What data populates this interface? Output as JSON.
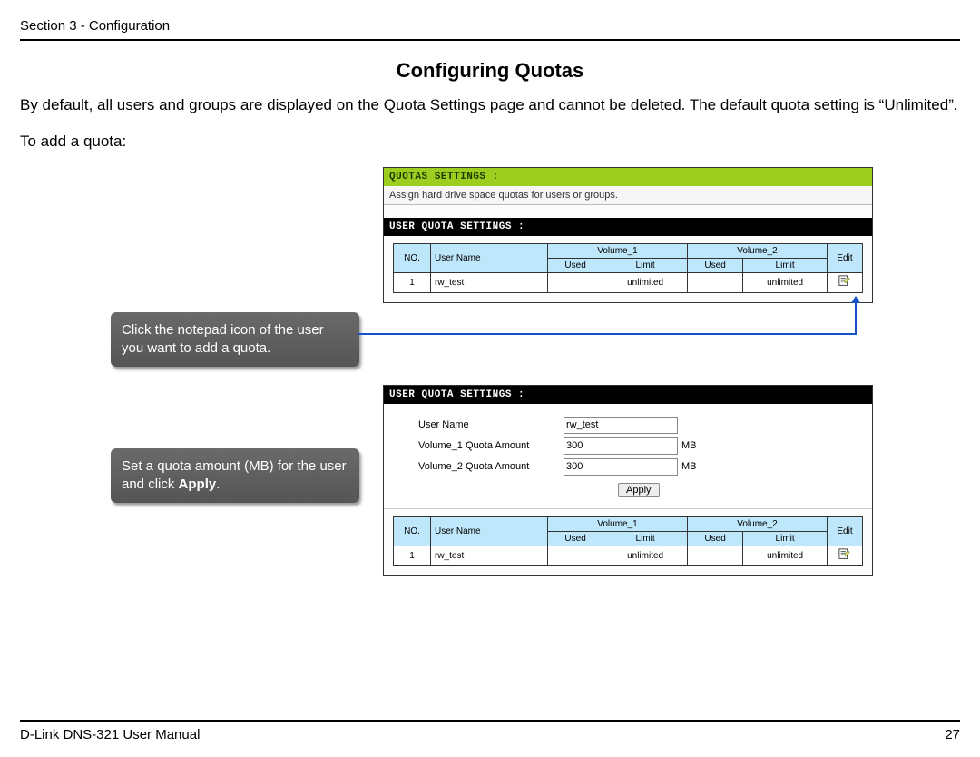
{
  "header": {
    "section": "Section 3 - Configuration"
  },
  "title": "Configuring Quotas",
  "para1": "By default, all users and groups are displayed on the Quota Settings page and cannot be deleted.  The default quota setting is “Unlimited”.",
  "para2": "To add a quota:",
  "callout1_a": "Click the notepad icon of the user you want to add a quota.",
  "callout2_a": "Set a quota amount (MB) for the user and click ",
  "callout2_b": "Apply",
  "callout2_c": ".",
  "panel1": {
    "title": "QUOTAS SETTINGS :",
    "sub": "Assign hard drive space quotas for users or groups.",
    "black": "USER QUOTA SETTINGS :",
    "cols": {
      "no": "NO.",
      "user": "User Name",
      "v1": "Volume_1",
      "v2": "Volume_2",
      "used": "Used",
      "limit": "Limit",
      "edit": "Edit"
    },
    "row": {
      "no": "1",
      "user": "rw_test",
      "v1_used": "",
      "v1_limit": "unlimited",
      "v2_used": "",
      "v2_limit": "unlimited"
    }
  },
  "panel2": {
    "black": "USER QUOTA SETTINGS :",
    "labels": {
      "user": "User Name",
      "v1q": "Volume_1 Quota Amount",
      "v2q": "Volume_2 Quota Amount",
      "mb": "MB",
      "apply": "Apply"
    },
    "values": {
      "user": "rw_test",
      "v1q": "300",
      "v2q": "300"
    },
    "cols": {
      "no": "NO.",
      "user": "User Name",
      "v1": "Volume_1",
      "v2": "Volume_2",
      "used": "Used",
      "limit": "Limit",
      "edit": "Edit"
    },
    "row": {
      "no": "1",
      "user": "rw_test",
      "v1_used": "",
      "v1_limit": "unlimited",
      "v2_used": "",
      "v2_limit": "unlimited"
    }
  },
  "footer": {
    "left": "D-Link DNS-321 User Manual",
    "right": "27"
  }
}
